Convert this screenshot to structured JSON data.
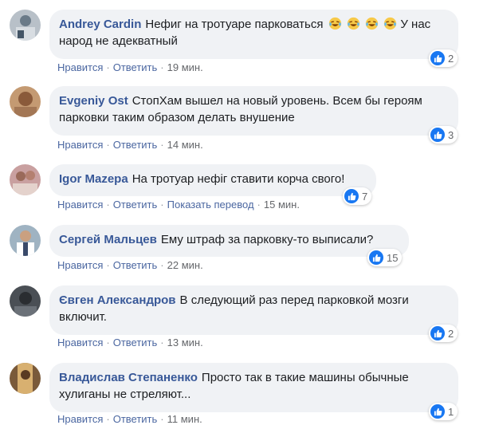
{
  "colors": {
    "bubble": "#f0f2f5",
    "author": "#385898",
    "link": "#4b67a1",
    "like": "#1877f2"
  },
  "comments": [
    {
      "author": "Andrey Cardin",
      "text": "Нефиг на тротуаре парковаться",
      "text2": "У нас народ не адекватный",
      "emoji": "laughing-tears-emoji",
      "like": "Нравится",
      "reply": "Ответить",
      "time": "19 мин.",
      "reactions": "2"
    },
    {
      "author": "Evgeniy Ost",
      "text": "СтопХам вышел на новый уровень. Всем бы героям парковки таким образом делать внушение",
      "like": "Нравится",
      "reply": "Ответить",
      "time": "14 мин.",
      "reactions": "3"
    },
    {
      "author": "Igor Mazepa",
      "text": "На тротуар нефіг ставити корча свого!",
      "like": "Нравится",
      "reply": "Ответить",
      "translate": "Показать перевод",
      "time": "15 мин.",
      "reactions": "7"
    },
    {
      "author": "Сергей Мальцев",
      "text": "Ему штраф за парковку-то выписали?",
      "like": "Нравится",
      "reply": "Ответить",
      "time": "22 мин.",
      "reactions": "15"
    },
    {
      "author": "Євген Александров",
      "text": "В следующий раз перед парковкой мозги включит.",
      "like": "Нравится",
      "reply": "Ответить",
      "time": "13 мин.",
      "reactions": "2"
    },
    {
      "author": "Владислав Степаненко",
      "text": "Просто так в такие машины обычные хулиганы не стреляют...",
      "like": "Нравится",
      "reply": "Ответить",
      "time": "11 мин.",
      "reactions": "1"
    }
  ]
}
